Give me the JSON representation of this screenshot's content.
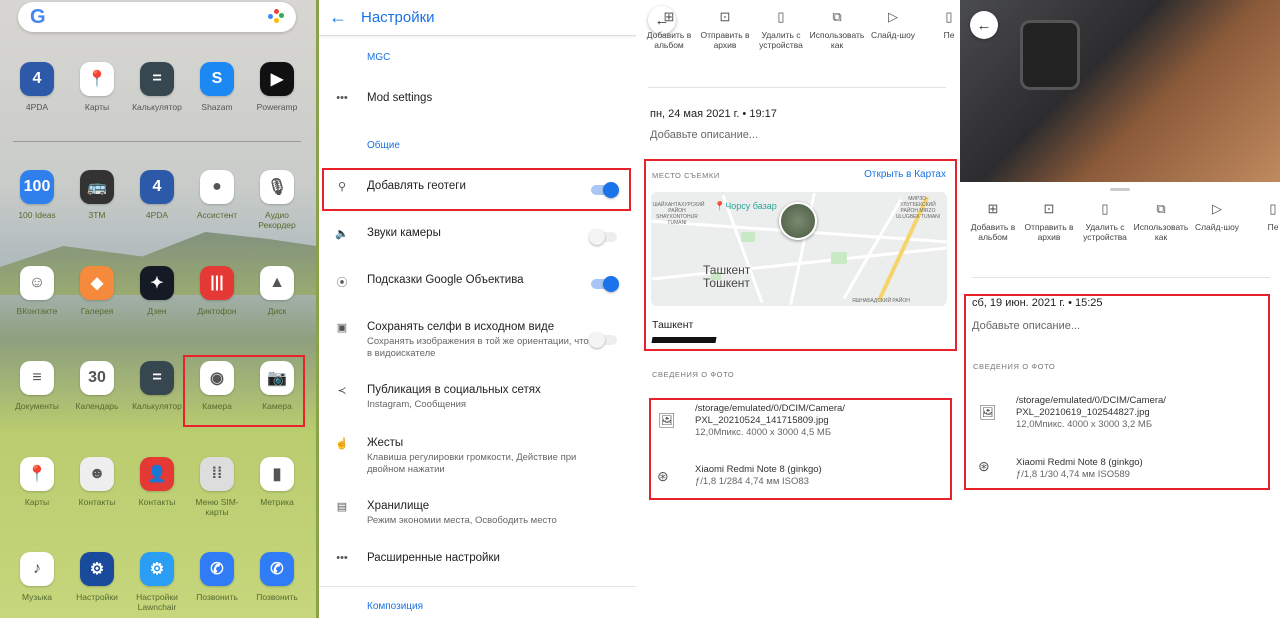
{
  "home": {
    "search_logo": "G",
    "rows": [
      [
        {
          "label": "4PDA",
          "glyph": "4",
          "color": "#2d5aa8"
        },
        {
          "label": "Карты",
          "glyph": "📍",
          "color": "#ffffff"
        },
        {
          "label": "Калькулятор",
          "glyph": "=",
          "color": "#37474f"
        },
        {
          "label": "Shazam",
          "glyph": "S",
          "color": "#1b88f4"
        },
        {
          "label": "Poweramp",
          "glyph": "▶",
          "color": "#111111"
        }
      ],
      [
        {
          "label": "100 Ideas",
          "glyph": "100",
          "color": "#2f80ed"
        },
        {
          "label": "3TM",
          "glyph": "🚌",
          "color": "#333333"
        },
        {
          "label": "4PDA",
          "glyph": "4",
          "color": "#2d5aa8"
        },
        {
          "label": "Ассистент",
          "glyph": "●",
          "color": "#ffffff"
        },
        {
          "label": "Аудио Рекордер",
          "glyph": "🎙",
          "color": "#ffffff"
        }
      ],
      [
        {
          "label": "ВКонтакте",
          "glyph": "☺",
          "color": "#ffffff"
        },
        {
          "label": "Галерея",
          "glyph": "◆",
          "color": "#f58a3c"
        },
        {
          "label": "Дзен",
          "glyph": "✦",
          "color": "#151a24"
        },
        {
          "label": "Диктофон",
          "glyph": "|||",
          "color": "#e53935"
        },
        {
          "label": "Диск",
          "glyph": "▲",
          "color": "#ffffff"
        }
      ],
      [
        {
          "label": "Документы",
          "glyph": "≡",
          "color": "#ffffff"
        },
        {
          "label": "Календарь",
          "glyph": "30",
          "color": "#ffffff"
        },
        {
          "label": "Калькулятор",
          "glyph": "=",
          "color": "#37474f"
        },
        {
          "label": "Камера",
          "glyph": "◉",
          "color": "#ffffff"
        },
        {
          "label": "Камера",
          "glyph": "📷",
          "color": "#ffffff"
        }
      ],
      [
        {
          "label": "Карты",
          "glyph": "📍",
          "color": "#ffffff"
        },
        {
          "label": "Контакты",
          "glyph": "☻",
          "color": "#eeeeee"
        },
        {
          "label": "Контакты",
          "glyph": "👤",
          "color": "#e53935"
        },
        {
          "label": "Меню SIM-карты",
          "glyph": "⁞⁞",
          "color": "#dddddd"
        },
        {
          "label": "Метрика",
          "glyph": "▮",
          "color": "#ffffff"
        }
      ],
      [
        {
          "label": "Музыка",
          "glyph": "♪",
          "color": "#ffffff"
        },
        {
          "label": "Настройки",
          "glyph": "⚙",
          "color": "#1a4a9c"
        },
        {
          "label": "Настройки Lawnchair",
          "glyph": "⚙",
          "color": "#2a9df4"
        },
        {
          "label": "Позвонить",
          "glyph": "✆",
          "color": "#2f7cf6"
        },
        {
          "label": "Позвонить",
          "glyph": "✆",
          "color": "#2f7cf6"
        }
      ]
    ]
  },
  "settings": {
    "title": "Настройки",
    "section_mgc": "MGC",
    "mod_settings": "Mod settings",
    "section_general": "Общие",
    "geotags": {
      "label": "Добавлять геотеги",
      "on": true
    },
    "camera_sounds": {
      "label": "Звуки камеры",
      "on": false
    },
    "lens": {
      "label": "Подсказки Google Объектива",
      "on": true
    },
    "selfie": {
      "label": "Сохранять селфи в исходном виде",
      "sub": "Сохранять изображения в той же ориентации, что и в видоискателе",
      "on": false
    },
    "social": {
      "label": "Публикация в социальных сетях",
      "sub": "Instagram, Сообщения"
    },
    "gestures": {
      "label": "Жесты",
      "sub": "Клавиша регулировки громкости, Действие при двойном нажатии"
    },
    "storage": {
      "label": "Хранилище",
      "sub": "Режим экономии места, Освободить место"
    },
    "advanced": {
      "label": "Расширенные настройки"
    },
    "section_composition": "Композиция",
    "accent": "#1a73e8"
  },
  "actions": [
    "Добавить в альбом",
    "Отправить в архив",
    "Удалить с устройства",
    "Использовать как",
    "Слайд-шоу",
    "Пе"
  ],
  "photo1": {
    "date": "пн, 24 мая 2021 г. • 19:17",
    "description_placeholder": "Добавьте описание...",
    "location_caption": "МЕСТО СЪЕМКИ",
    "open_in_maps": "Открыть в Картах",
    "map": {
      "city": "Ташкент",
      "city2": "Тошкент",
      "poi": "Чорсу базар",
      "d1": "ШАЙХАНТАХУРСКИЙ РАЙОН SHAYXONTOHUR TUMANI",
      "d2": "МИРЗО-УЛУГБЕКСКИЙ РАЙОН MIRZO ULUGBEK TUMANI",
      "d3": "ЯШНАБАДСКИЙ РАЙОН"
    },
    "place": "Ташкент",
    "info_caption": "СВЕДЕНИЯ О ФОТО",
    "path": "/storage/emulated/0/DCIM/Camera/",
    "file": "PXL_20210524_141715809.jpg",
    "file_meta": "12,0Мпикс.    4000 x 3000    4,5 МБ",
    "device": "Xiaomi Redmi Note 8 (ginkgo)",
    "exif": "ƒ/1,8    1/284    4,74 мм    ISO83"
  },
  "photo2": {
    "date": "сб, 19 июн. 2021 г. • 15:25",
    "description_placeholder": "Добавьте описание...",
    "info_caption": "СВЕДЕНИЯ О ФОТО",
    "path": "/storage/emulated/0/DCIM/Camera/",
    "file": "PXL_20210619_102544827.jpg",
    "file_meta": "12,0Мпикс.    4000 x 3000    3,2 МБ",
    "device": "Xiaomi Redmi Note 8 (ginkgo)",
    "exif": "ƒ/1,8    1/30    4,74 мм    ISO589"
  },
  "highlight_color": "#e8212b"
}
